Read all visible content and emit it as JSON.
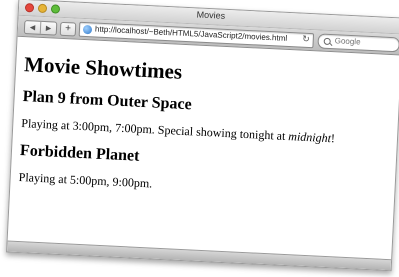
{
  "window": {
    "title": "Movies"
  },
  "toolbar": {
    "back_label": "◀",
    "forward_label": "▶",
    "add_label": "+",
    "url": "http://localhost/~Beth/HTML5/JavaScript2/movies.html",
    "reload_label": "↻",
    "search_placeholder": "Google"
  },
  "page": {
    "heading": "Movie Showtimes",
    "movies": [
      {
        "title": "Plan 9 from Outer Space",
        "showtimes_text": "Playing at 3:00pm, 7:00pm. Special showing tonight at ",
        "emphasis": "midnight",
        "trailing": "!"
      },
      {
        "title": "Forbidden Planet",
        "showtimes_text": "Playing at 5:00pm, 9:00pm."
      }
    ]
  }
}
